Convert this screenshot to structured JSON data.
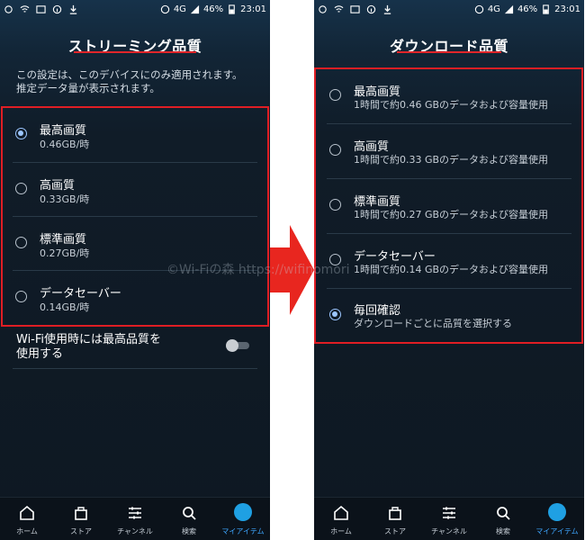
{
  "status_bar": {
    "network": "4G",
    "battery": "46%",
    "time": "23:01"
  },
  "left": {
    "title": "ストリーミング品質",
    "description": [
      "この設定は、このデバイスにのみ適用されます。",
      "推定データ量が表示されます。"
    ],
    "options": [
      {
        "label": "最高画質",
        "sub": "0.46GB/時",
        "selected": true
      },
      {
        "label": "高画質",
        "sub": "0.33GB/時",
        "selected": false
      },
      {
        "label": "標準画質",
        "sub": "0.27GB/時",
        "selected": false
      },
      {
        "label": "データセーバー",
        "sub": "0.14GB/時",
        "selected": false
      }
    ],
    "wifi_setting": {
      "line1": "Wi-Fi使用時には最高品質を",
      "line2": "使用する",
      "enabled": false
    }
  },
  "right": {
    "title": "ダウンロード品質",
    "options": [
      {
        "label": "最高画質",
        "sub": "1時間で約0.46 GBのデータおよび容量使用",
        "selected": false
      },
      {
        "label": "高画質",
        "sub": "1時間で約0.33 GBのデータおよび容量使用",
        "selected": false
      },
      {
        "label": "標準画質",
        "sub": "1時間で約0.27 GBのデータおよび容量使用",
        "selected": false
      },
      {
        "label": "データセーバー",
        "sub": "1時間で約0.14 GBのデータおよび容量使用",
        "selected": false
      },
      {
        "label": "毎回確認",
        "sub": "ダウンロードごとに品質を選択する",
        "selected": true
      }
    ]
  },
  "nav": {
    "items": [
      {
        "label": "ホーム",
        "icon": "home-icon"
      },
      {
        "label": "ストア",
        "icon": "store-bag-icon"
      },
      {
        "label": "チャンネル",
        "icon": "channels-icon"
      },
      {
        "label": "検索",
        "icon": "search-icon"
      },
      {
        "label": "マイアイテム",
        "icon": "avatar-icon",
        "active": true
      }
    ]
  },
  "watermark": "©Wi-Fiの森 https://wifinomori",
  "colors": {
    "highlight_box": "#e01e24",
    "title_underline": "#e0262a",
    "arrow": "#e8261f",
    "accent": "#3ea6ff",
    "radio_selected": "#9cc6ff"
  }
}
